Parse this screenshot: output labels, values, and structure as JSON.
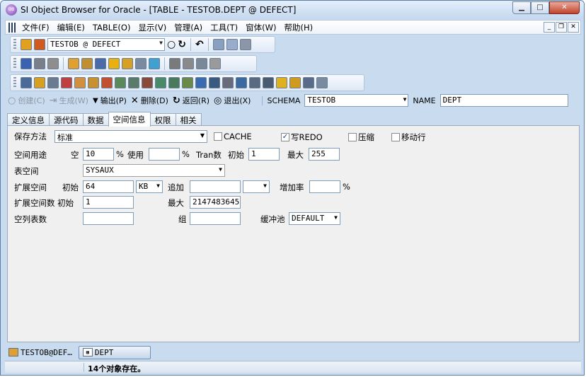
{
  "window": {
    "title": "SI Object Browser for Oracle - [TABLE - TESTOB.DEPT @ DEFECT]",
    "app_icon_text": "OB",
    "min_symbol": "▁",
    "max_symbol": "□",
    "close_symbol": "✕"
  },
  "menubar": {
    "items": [
      "文件(F)",
      "编辑(E)",
      "TABLE(O)",
      "显示(V)",
      "管理(A)",
      "工具(T)",
      "窗体(W)",
      "帮助(H)"
    ],
    "mdi_min": "_",
    "mdi_restore": "❐",
    "mdi_close": "✕"
  },
  "toolbar1": {
    "connection_value": "TESTOB @ DEFECT",
    "refresh_symbol": "↻",
    "stop_symbol": "○",
    "undo_symbol": "↶"
  },
  "actionbar": {
    "create_label": "创建(C)",
    "generate_label": "生成(W)",
    "output_label": "输出(P)",
    "delete_label": "删除(D)",
    "back_label": "返回(R)",
    "exit_label": "退出(X)",
    "schema_label": "SCHEMA",
    "schema_value": "TESTOB",
    "name_label": "NAME",
    "name_value": "DEPT"
  },
  "tabs": [
    {
      "label": "定义信息",
      "active": false
    },
    {
      "label": "源代码",
      "active": false
    },
    {
      "label": "数据",
      "active": false
    },
    {
      "label": "空间信息",
      "active": true
    },
    {
      "label": "权限",
      "active": false
    },
    {
      "label": "相关",
      "active": false
    }
  ],
  "form": {
    "storage_method_label": "保存方法",
    "storage_method_value": "标准",
    "cache_label": "CACHE",
    "cache_checked": false,
    "redo_label": "写REDO",
    "redo_checked": true,
    "compress_label": "压缩",
    "compress_checked": false,
    "row_movement_label": "移动行",
    "row_movement_checked": false,
    "space_usage_label": "空间用途",
    "free_label": "空",
    "free_value": "10",
    "percent1": "%",
    "used_label": "使用",
    "used_value": "",
    "percent2": "%",
    "tran_label": "Tran数",
    "initial_label": "初始",
    "initial_value": "1",
    "max_label": "最大",
    "max_value": "255",
    "tablespace_label": "表空间",
    "tablespace_value": "SYSAUX",
    "extent_label": "扩展空间",
    "extent_initial_label": "初始",
    "extent_initial_value": "64",
    "extent_unit_value": "KB",
    "next_label": "追加",
    "next_value": "",
    "next_unit_value": "",
    "pct_increase_label": "增加率",
    "pct_increase_value": "",
    "percent3": "%",
    "extents_label": "扩展空间数 初始",
    "extents_initial_value": "1",
    "extents_max_label": "最大",
    "extents_max_value": "2147483645",
    "freelists_label": "空列表数",
    "freelists_value": "",
    "group_label": "组",
    "group_value": "",
    "buffer_pool_label": "缓冲池",
    "buffer_pool_value": "DEFAULT"
  },
  "taskbar": {
    "items": [
      {
        "label": "TESTOB@DEF…",
        "active": false
      },
      {
        "label": "DEPT",
        "active": true
      }
    ]
  },
  "status": {
    "message": "14个对象存在。"
  }
}
